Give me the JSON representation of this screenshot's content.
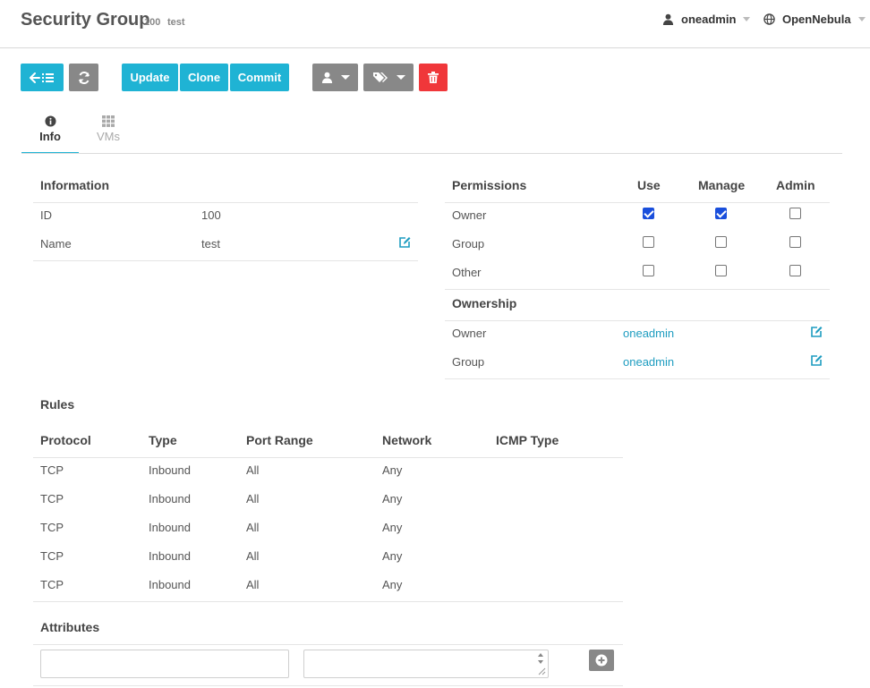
{
  "header": {
    "title": "Security Group",
    "id": "100",
    "name": "test",
    "user": "oneadmin",
    "zone": "OpenNebula"
  },
  "toolbar": {
    "update_label": "Update",
    "clone_label": "Clone",
    "commit_label": "Commit"
  },
  "tabs": [
    {
      "label": "Info",
      "icon": "info-icon",
      "active": true
    },
    {
      "label": "VMs",
      "icon": "grid-icon",
      "active": false
    }
  ],
  "information": {
    "heading": "Information",
    "rows": [
      {
        "label": "ID",
        "value": "100"
      },
      {
        "label": "Name",
        "value": "test"
      }
    ]
  },
  "permissions": {
    "heading": "Permissions",
    "columns": [
      "Use",
      "Manage",
      "Admin"
    ],
    "rows": [
      {
        "label": "Owner",
        "use": true,
        "manage": true,
        "admin": false
      },
      {
        "label": "Group",
        "use": false,
        "manage": false,
        "admin": false
      },
      {
        "label": "Other",
        "use": false,
        "manage": false,
        "admin": false
      }
    ]
  },
  "ownership": {
    "heading": "Ownership",
    "rows": [
      {
        "label": "Owner",
        "value": "oneadmin"
      },
      {
        "label": "Group",
        "value": "oneadmin"
      }
    ]
  },
  "rules": {
    "heading": "Rules",
    "columns": [
      "Protocol",
      "Type",
      "Port Range",
      "Network",
      "ICMP Type"
    ],
    "rows": [
      [
        "TCP",
        "Inbound",
        "All",
        "Any",
        ""
      ],
      [
        "TCP",
        "Inbound",
        "All",
        "Any",
        ""
      ],
      [
        "TCP",
        "Inbound",
        "All",
        "Any",
        ""
      ],
      [
        "TCP",
        "Inbound",
        "All",
        "Any",
        ""
      ],
      [
        "TCP",
        "Inbound",
        "All",
        "Any",
        ""
      ]
    ]
  },
  "attributes": {
    "heading": "Attributes",
    "key_value": "",
    "value_value": ""
  },
  "colors": {
    "accent": "#1fb3d4",
    "gray_button": "#888888",
    "danger": "#f0373a",
    "link": "#1d9cc0"
  }
}
